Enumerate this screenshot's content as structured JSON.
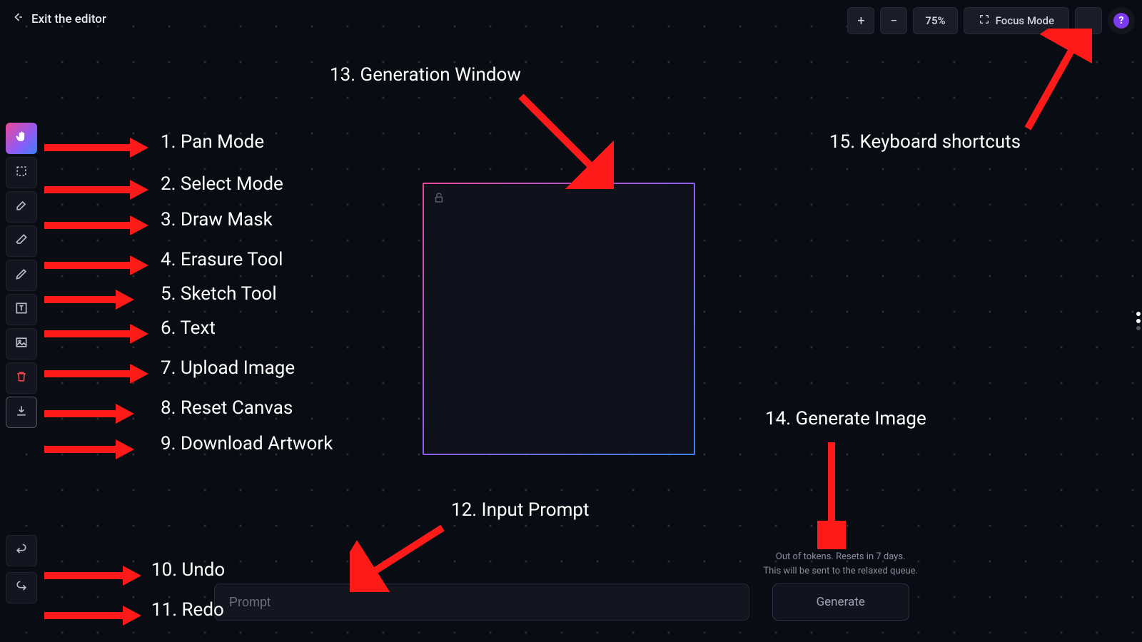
{
  "header": {
    "exit_label": "Exit the editor",
    "zoom": "75%",
    "focus_mode_label": "Focus Mode"
  },
  "tools": {
    "pan": "Pan Mode",
    "select": "Select Mode",
    "mask": "Draw Mask",
    "erase": "Erasure Tool",
    "sketch": "Sketch Tool",
    "text": "Text",
    "upload": "Upload Image",
    "reset": "Reset Canvas",
    "download": "Download Artwork",
    "undo": "Undo",
    "redo": "Redo"
  },
  "prompt": {
    "placeholder": "Prompt"
  },
  "generate": {
    "status_line1": "Out of tokens. Resets in 7 days.",
    "status_line2": "This will be sent to the relaxed queue.",
    "button": "Generate"
  },
  "annotations": {
    "n1": "1.  Pan Mode",
    "n2": "2.  Select Mode",
    "n3": "3.  Draw Mask",
    "n4": "4.  Erasure Tool",
    "n5": "5.  Sketch Tool",
    "n6": "6.  Text",
    "n7": "7.  Upload Image",
    "n8": "8.  Reset Canvas",
    "n9": "9.  Download Artwork",
    "n10": "10.  Undo",
    "n11": "11.  Redo",
    "n12": "12. Input Prompt",
    "n13": "13. Generation Window",
    "n14": "14. Generate Image",
    "n15": "15. Keyboard shortcuts"
  }
}
